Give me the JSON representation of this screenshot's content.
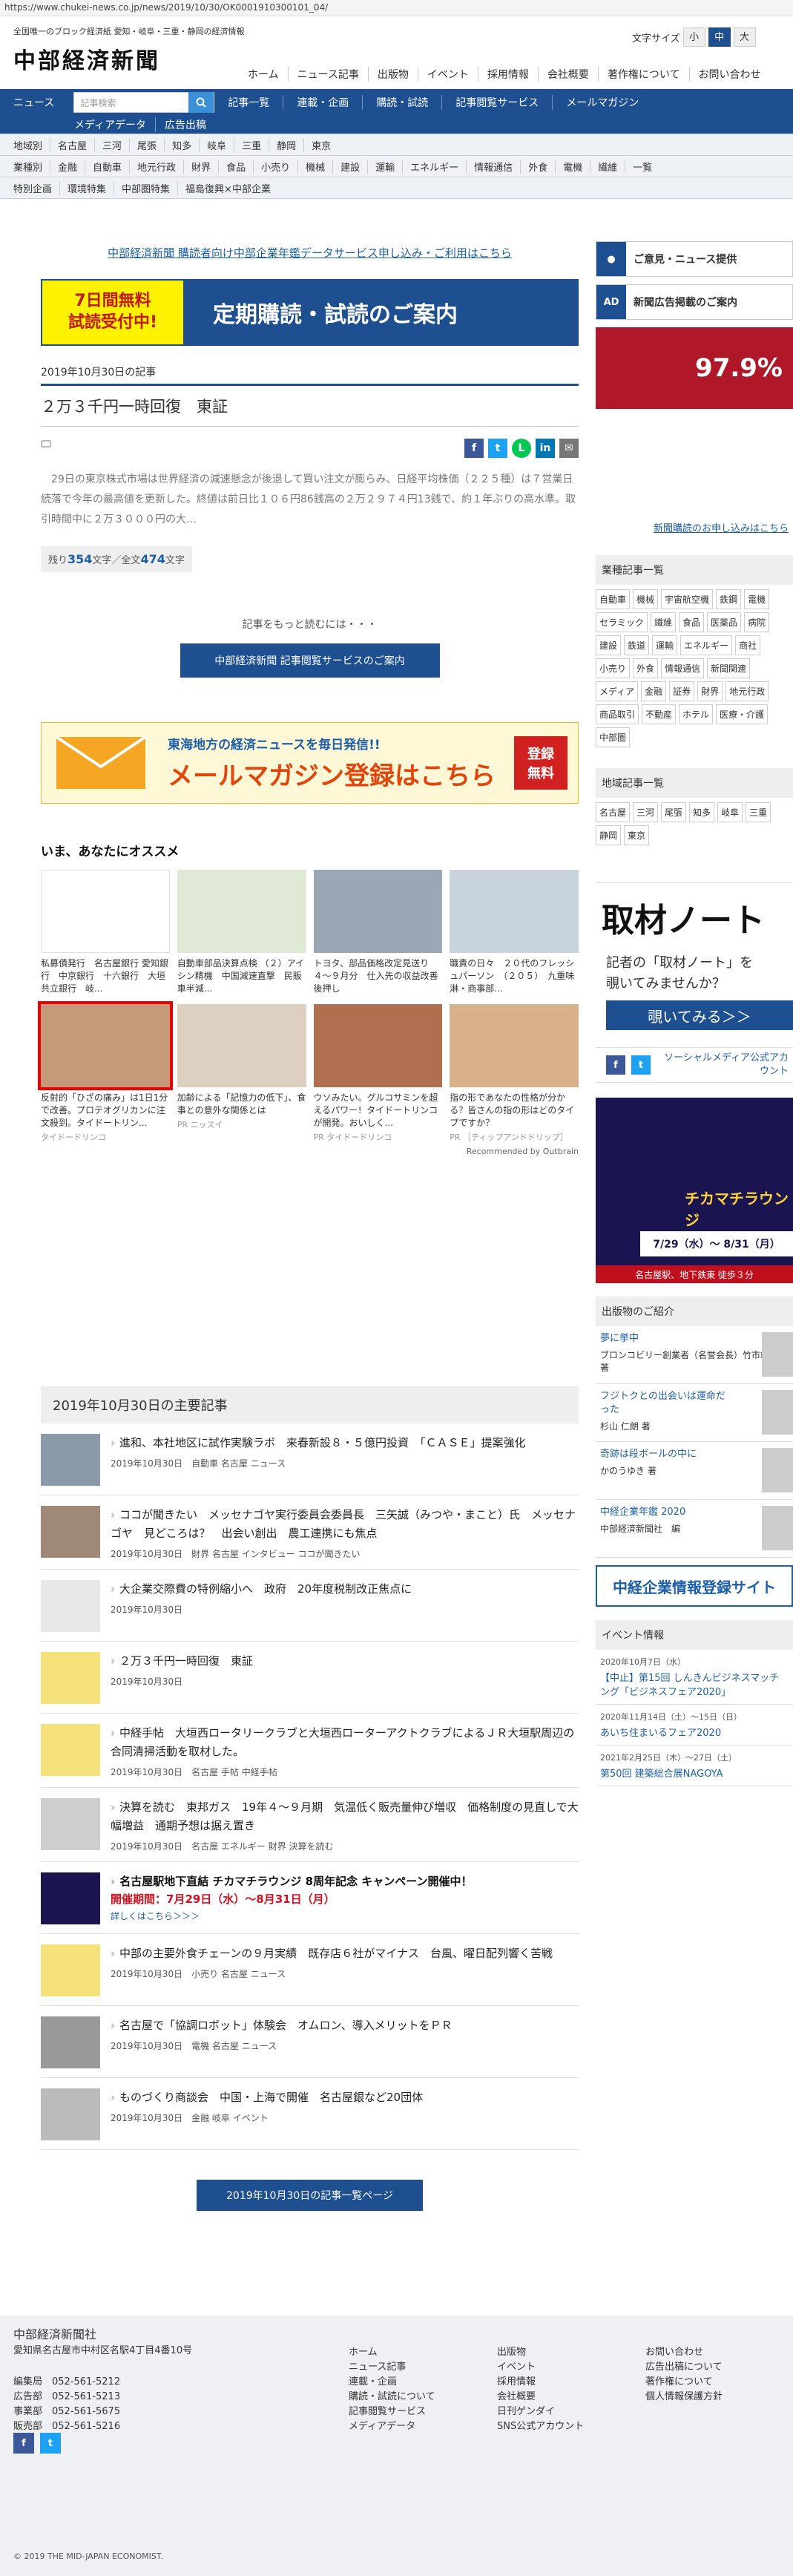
{
  "url": "https://www.chukei-news.co.jp/news/2019/10/30/OK0001910300101_04/",
  "header": {
    "tagline": "全国唯一のブロック経済紙 愛知・岐阜・三重・静岡の経済情報",
    "logo": "中部経済新聞",
    "font_label": "文字サイズ",
    "font_sizes": [
      "小",
      "中",
      "大"
    ],
    "nav": [
      "ホーム",
      "ニュース記事",
      "出版物",
      "イベント",
      "採用情報",
      "会社概要",
      "著作権について",
      "お問い合わせ"
    ]
  },
  "bluenav": {
    "row1": [
      "ニュース",
      "記事一覧",
      "連載・企画",
      "購読・試読",
      "記事閲覧サービス",
      "メールマガジン"
    ],
    "search_placeholder": "記事検索",
    "row2": [
      "メディアデータ",
      "広告出稿"
    ]
  },
  "cats": [
    [
      "地域別",
      "名古屋",
      "三河",
      "尾張",
      "知多",
      "岐阜",
      "三重",
      "静岡",
      "東京"
    ],
    [
      "業種別",
      "金融",
      "自動車",
      "地元行政",
      "財界",
      "食品",
      "小売り",
      "機械",
      "建設",
      "運輸",
      "エネルギー",
      "情報通信",
      "外食",
      "電機",
      "繊維",
      "一覧"
    ],
    [
      "特別企画",
      "環境特集",
      "中部圏特集",
      "福島復興×中部企業"
    ]
  ],
  "article": {
    "banner": "中部経済新聞 購読者向け中部企業年鑑データサービス申し込み・ご利用はこちら",
    "trial_left": [
      "7日間無料",
      "試読受付中!"
    ],
    "trial_right": "定期購読・試読のご案内",
    "date": "2019年10月30日の記事",
    "title": "２万３千円一時回復　東証",
    "body": "　29日の東京株式市場は世界経済の減速懸念が後退して買い注文が膨らみ、日経平均株価（２２５種）は７営業日続落で今年の最高値を更新した。終値は前日比１０６円86銭高の２万２９７４円13銭で、約１年ぶりの高水準。取引時間中に２万３０００円の大…",
    "count_prefix": "残り",
    "count_rest": "354",
    "count_mid": "文字／全文",
    "count_total": "474",
    "count_suffix": "文字",
    "more_text": "記事をもっと読むには・・・",
    "more_btn": "中部経済新聞 記事閲覧サービスのご案内"
  },
  "mailmag": {
    "t1": "東海地方の経済ニュースを毎日発信!!",
    "t2": "メールマガジン登録はこちら",
    "reg": [
      "登録",
      "無料"
    ]
  },
  "recommend": {
    "heading": "いま、あなたにオススメ",
    "items": [
      {
        "text": "私募債発行　名古屋銀行 愛知銀行　中京銀行　十六銀行　大垣共立銀行　岐...",
        "pr": ""
      },
      {
        "text": "自動車部品決算点検 （２）アイシン精機　中国減速直撃　民販車半減...",
        "pr": ""
      },
      {
        "text": "トヨタ、部品価格改定見送り　４～９月分　仕入先の収益改善後押し",
        "pr": ""
      },
      {
        "text": "職責の日々　２０代のフレッシュパーソン　（２０５）　九重味淋・商事部...",
        "pr": ""
      },
      {
        "text": "反射的「ひざの痛み」は1日1分で改善。プロテオグリカンに注文殺到。タイドートリン...",
        "pr": "タイドードリンコ"
      },
      {
        "text": "加齢による「記憶力の低下」、食事との意外な関係とは",
        "pr": "PR ニッスイ"
      },
      {
        "text": "ウソみたい。グルコサミンを超えるパワー！タイドートリンコが開発。おいしく...",
        "pr": "PR タイドードリンコ"
      },
      {
        "text": "指の形であなたの性格が分かる？皆さんの指の形はどのタイプですか？",
        "pr": "PR ［ティップアンドドリップ］"
      }
    ],
    "outbrain": "Recommended by Outbrain"
  },
  "main_list": {
    "heading": "2019年10月30日の主要記事",
    "items": [
      {
        "title": "進和、本社地区に試作実験ラボ　来春新設８・５億円投資　「ＣＡＳＥ」提案強化",
        "date": "2019年10月30日",
        "cats": "自動車 名古屋 ニュース"
      },
      {
        "title": "ココが聞きたい　メッセナゴヤ実行委員会委員長　三矢誠（みつや・まこと）氏　メッセナゴヤ　見どころは？　出会い創出　農工連携にも焦点",
        "date": "2019年10月30日",
        "cats": "財界 名古屋 インタビュー ココが聞きたい"
      },
      {
        "title": "大企業交際費の特例縮小へ　政府　20年度税制改正焦点に",
        "date": "2019年10月30日",
        "cats": ""
      },
      {
        "title": "２万３千円一時回復　東証",
        "date": "2019年10月30日",
        "cats": ""
      },
      {
        "title": "中経手帖　大垣西ロータリークラブと大垣西ローターアクトクラブによるＪＲ大垣駅周辺の合同清掃活動を取材した。",
        "date": "2019年10月30日",
        "cats": "名古屋 手帖 中経手帖"
      },
      {
        "title": "決算を読む　東邦ガス　19年４～９月期　気温低く販売量伸び増収　価格制度の見直しで大幅増益　通期予想は据え置き",
        "date": "2019年10月30日",
        "cats": "名古屋 エネルギー 財界 決算を読む"
      },
      {
        "title": "中部の主要外食チェーンの９月実績　既存店６社がマイナス　台風、曜日配列響く苦戦",
        "date": "2019年10月30日",
        "cats": "小売り 名古屋 ニュース"
      },
      {
        "title": "名古屋で「協調ロボット」体験会　オムロン、導入メリットをＰＲ",
        "date": "2019年10月30日",
        "cats": "電機 名古屋 ニュース"
      },
      {
        "title": "ものづくり商談会　中国・上海で開催　名古屋銀など20団体",
        "date": "2019年10月30日",
        "cats": "金融 岐阜 イベント"
      }
    ],
    "hot": {
      "title": "名古屋駅地下直結 チカマチラウンジ 8周年記念 キャンペーン開催中！",
      "sub": "開催期間：7月29日（水）～8月31日（月）",
      "det": "詳しくはこちら＞＞＞"
    },
    "list_btn": "2019年10月30日の記事一覧ページ"
  },
  "side": {
    "box1": "ご意見・ニュース提供",
    "box2": "新聞広告掲載のご案内",
    "ad_rate": "97.9%",
    "subscribe_link": "新聞購読のお申し込みはこちら",
    "ind_h": "業種記事一覧",
    "ind": [
      "自動車",
      "機械",
      "宇宙航空機",
      "鉄鋼",
      "電機",
      "セラミック",
      "繊維",
      "食品",
      "医薬品",
      "病院",
      "建設",
      "鉄道",
      "運輸",
      "エネルギー",
      "商社",
      "小売り",
      "外食",
      "情報通信",
      "新聞関連",
      "メディア",
      "金融",
      "証券",
      "財界",
      "地元行政",
      "商品取引",
      "不動産",
      "ホテル",
      "医療・介護",
      "中部圏"
    ],
    "reg_h": "地域記事一覧",
    "reg": [
      "名古屋",
      "三河",
      "尾張",
      "知多",
      "岐阜",
      "三重",
      "静岡",
      "東京"
    ],
    "tosai_big": "取材ノート",
    "tosai_q1": "記者の「取材ノート」を",
    "tosai_q2": "覗いてみませんか？",
    "tosai_btn": "覗いてみる＞＞",
    "social": "ソーシャルメディア公式アカウント",
    "lounge": "チカマチラウンジ",
    "lounge_date": "7/29（水）～ 8/31（月）",
    "lounge_foot": "名古屋駅、地下鉄東 徒歩３分",
    "books_h": "出版物のご紹介",
    "books": [
      {
        "t": "夢に挙中",
        "a": "ブロンコビリー創業者（名誉会長）竹市靖公 著"
      },
      {
        "t": "フジトクとの出会いは運命だった",
        "a": "杉山 仁朗 著"
      },
      {
        "t": "奇跡は段ボールの中に",
        "a": "かのうゆき 著"
      },
      {
        "t": "中経企業年鑑 2020",
        "a": "中部経済新聞社　編"
      }
    ],
    "yb": "中経企業情報登録サイト",
    "ev_h": "イベント情報",
    "ev": [
      {
        "d": "2020年10月7日（水）",
        "n": "【中止】第15回 しんきんビジネスマッチング「ビジネスフェア2020」"
      },
      {
        "d": "2020年11月14日（土）～15日（日）",
        "n": "あいち住まいるフェア2020"
      },
      {
        "d": "2021年2月25日（木）～27日（土）",
        "n": "第50回 建築総合展NAGOYA"
      }
    ]
  },
  "footer": {
    "co": "中部経済新聞社",
    "addr": "愛知県名古屋市中村区名駅4丁目4番10号",
    "tel": [
      "編集局　052-561-5212",
      "広告部　052-561-5213",
      "事業部　052-561-5675",
      "販売部　052-561-5216"
    ],
    "c1": [
      "ホーム",
      "ニュース記事",
      "連載・企画",
      "購読・試読について",
      "記事閲覧サービス",
      "メディアデータ"
    ],
    "c2": [
      "出版物",
      "イベント",
      "採用情報",
      "会社概要",
      "日刊ゲンダイ",
      "SNS公式アカウント"
    ],
    "c3": [
      "お問い合わせ",
      "広告出稿について",
      "著作権について",
      "個人情報保護方針"
    ],
    "copy": "© 2019 THE MID-JAPAN ECONOMIST."
  }
}
